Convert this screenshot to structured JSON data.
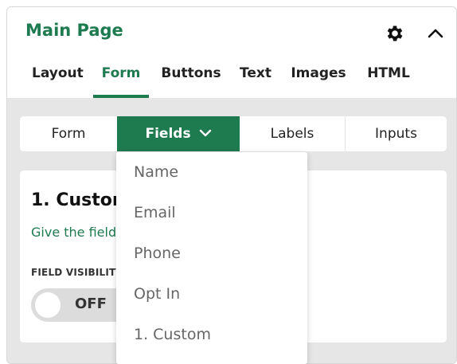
{
  "header": {
    "title": "Main Page",
    "icons": [
      "gear-icon",
      "chevron-up-icon"
    ]
  },
  "tabs": [
    {
      "label": "Layout",
      "active": false
    },
    {
      "label": "Form",
      "active": true
    },
    {
      "label": "Buttons",
      "active": false
    },
    {
      "label": "Text",
      "active": false
    },
    {
      "label": "Images",
      "active": false
    },
    {
      "label": "HTML",
      "active": false
    }
  ],
  "subtabs": [
    {
      "label": "Form",
      "active": false
    },
    {
      "label": "Fields",
      "active": true
    },
    {
      "label": "Labels",
      "active": false
    },
    {
      "label": "Inputs",
      "active": false
    }
  ],
  "card": {
    "title": "1. Custom",
    "description": "Give the field",
    "visibility_label": "FIELD VISIBILITY",
    "toggle_value": "OFF"
  },
  "dropdown": {
    "items": [
      "Name",
      "Email",
      "Phone",
      "Opt In",
      "1. Custom"
    ]
  },
  "colors": {
    "accent": "#1e7a4f",
    "background": "#e6e6e6"
  }
}
